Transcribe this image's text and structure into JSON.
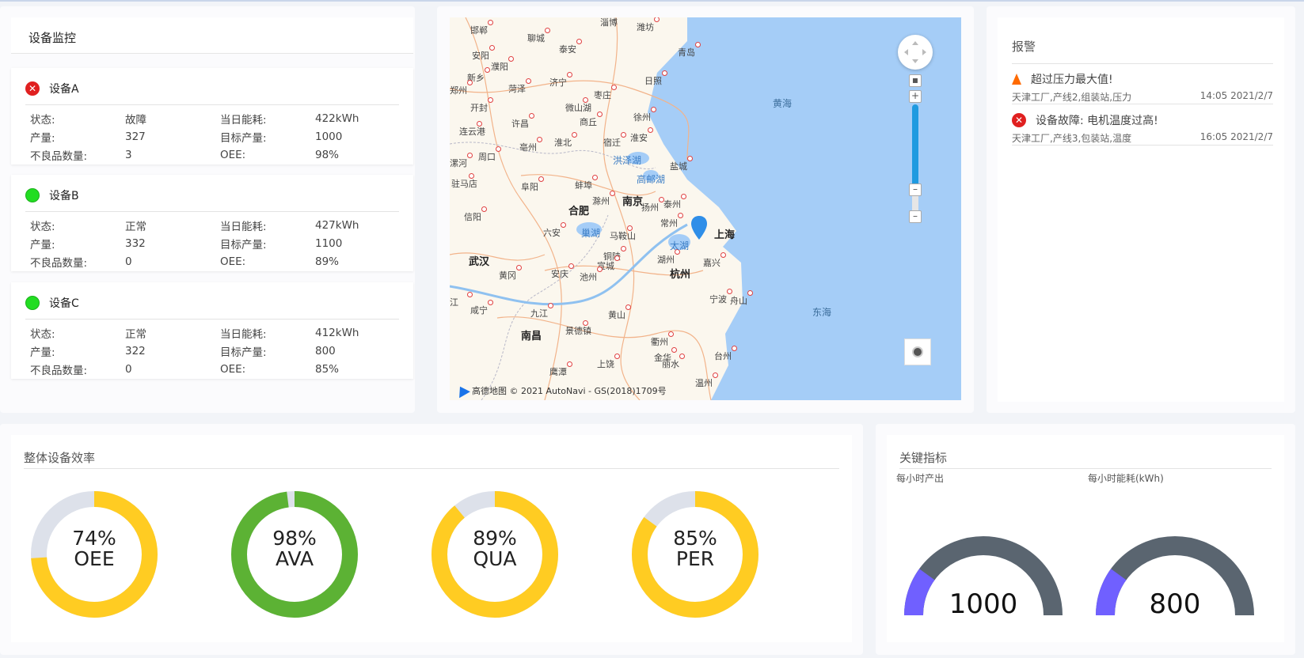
{
  "monitor": {
    "title": "设备监控",
    "labels": {
      "status": "状态:",
      "output": "产量:",
      "defects": "不良品数量:",
      "energy": "当日能耗:",
      "target": "目标产量:",
      "oee": "OEE:"
    },
    "devices": [
      {
        "name": "设备A",
        "state": "error",
        "status": "故障",
        "output": "327",
        "defects": "3",
        "energy": "422kWh",
        "target": "1000",
        "oee": "98%"
      },
      {
        "name": "设备B",
        "state": "ok",
        "status": "正常",
        "output": "332",
        "defects": "0",
        "energy": "427kWh",
        "target": "1100",
        "oee": "89%"
      },
      {
        "name": "设备C",
        "state": "ok",
        "status": "正常",
        "output": "322",
        "defects": "0",
        "energy": "412kWh",
        "target": "800",
        "oee": "85%"
      }
    ]
  },
  "map": {
    "credit": "高德地图 © 2021 AutoNavi - GS(2018)1709号",
    "cities_big": [
      "合肥",
      "南京",
      "上海",
      "杭州",
      "武汉",
      "南昌"
    ],
    "cities": [
      "邯郸",
      "淄博",
      "潍坊",
      "聊城",
      "青岛",
      "安阳",
      "泰安",
      "濮阳",
      "新乡",
      "菏泽",
      "济宁",
      "日照",
      "枣庄",
      "开封",
      "微山湖",
      "许昌",
      "商丘",
      "徐州",
      "连云港",
      "周口",
      "亳州",
      "淮北",
      "宿迁",
      "淮安",
      "漯河",
      "盐城",
      "驻马店",
      "阜阳",
      "蚌埠",
      "滁州",
      "扬州",
      "泰州",
      "信阳",
      "六安",
      "常州",
      "马鞍山",
      "铜陵",
      "宣城",
      "湖州",
      "嘉兴",
      "黄冈",
      "安庆",
      "池州",
      "宁波",
      "舟山",
      "九江",
      "黄山",
      "咸宁",
      "景德镇",
      "衢州",
      "金华",
      "上饶",
      "丽水",
      "台州",
      "鹰潭",
      "温州",
      "郑州",
      "江"
    ],
    "waters": [
      "洪泽湖",
      "高邮湖",
      "巢湖",
      "太湖"
    ],
    "seas": [
      "黄海",
      "东海"
    ]
  },
  "alarm": {
    "title": "报警",
    "items": [
      {
        "type": "warning",
        "icon": "warning-triangle-icon",
        "message": "超过压力最大值!",
        "source": "天津工厂,产线2,组装站,压力",
        "time": "14:05 2021/2/7"
      },
      {
        "type": "error",
        "icon": "error-circle-icon",
        "message": "设备故障: 电机温度过高!",
        "source": "天津工厂,产线3,包装站,温度",
        "time": "16:05 2021/2/7"
      }
    ]
  },
  "oee": {
    "title": "整体设备效率",
    "gauges": [
      {
        "value": 74,
        "label": "74%",
        "name": "OEE",
        "color": "#ffcc22"
      },
      {
        "value": 98,
        "label": "98%",
        "name": "AVA",
        "color": "#5cb234"
      },
      {
        "value": 89,
        "label": "89%",
        "name": "QUA",
        "color": "#ffcc22"
      },
      {
        "value": 85,
        "label": "85%",
        "name": "PER",
        "color": "#ffcc22"
      }
    ],
    "track_color": "#dde1ea"
  },
  "kpi": {
    "title": "关键指标",
    "items": [
      {
        "label": "每小时产出",
        "value": "1000",
        "fraction": 0.2
      },
      {
        "label": "每小时能耗(kWh)",
        "value": "800",
        "fraction": 0.2
      }
    ],
    "accent": "#7060ff",
    "track": "#5a6570"
  }
}
